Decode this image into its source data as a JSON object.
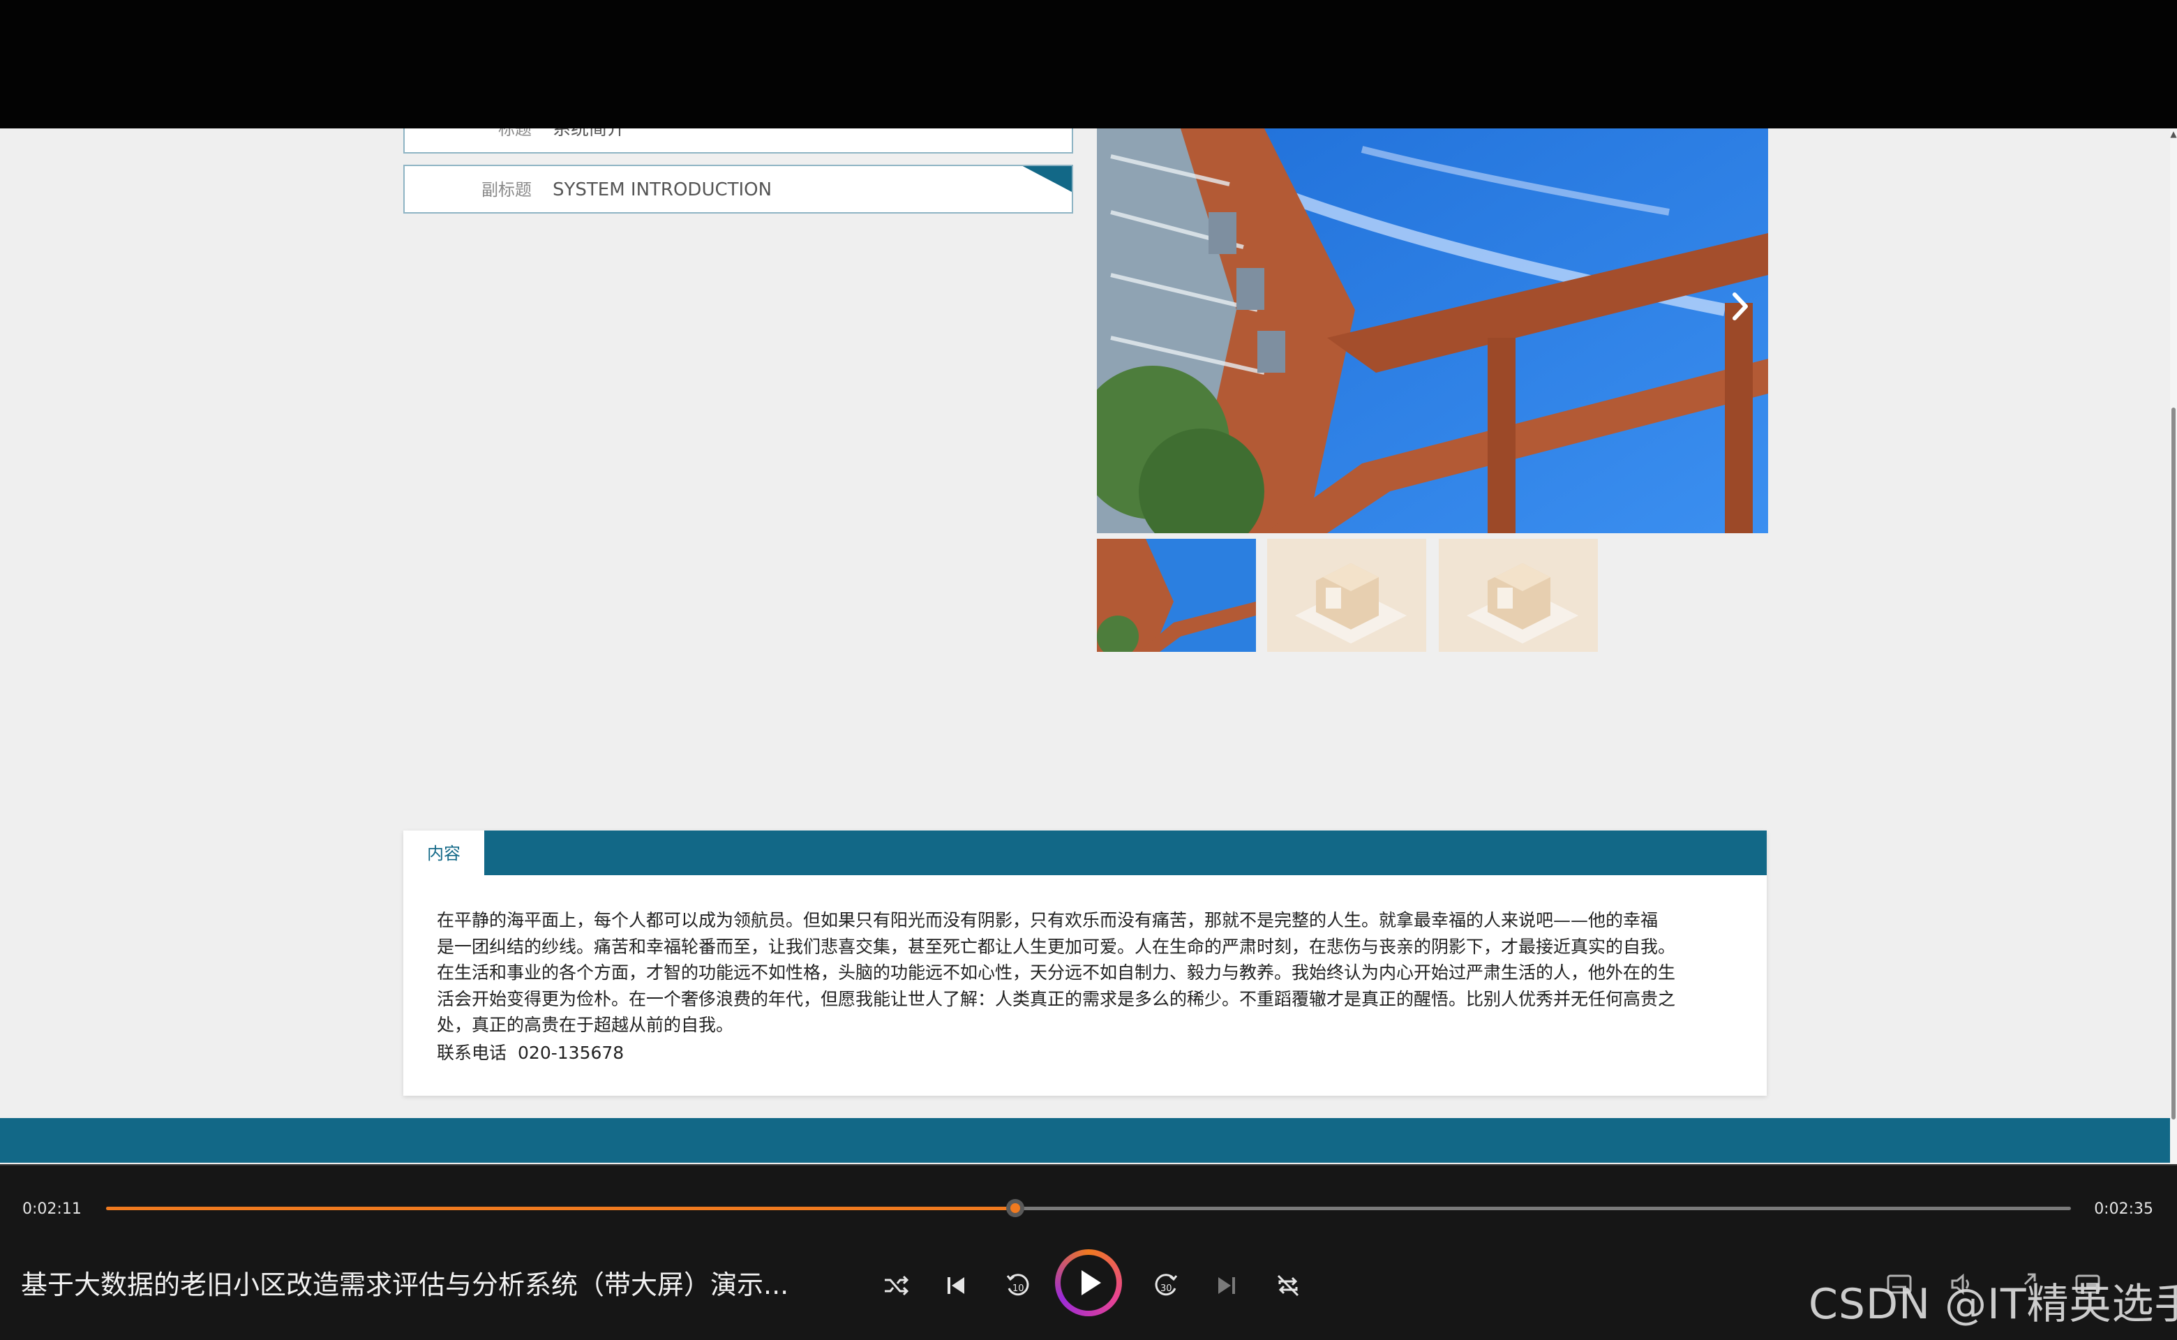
{
  "form": {
    "title_label": "标题",
    "title_value": "系统简介",
    "subtitle_label": "副标题",
    "subtitle_value": "SYSTEM INTRODUCTION"
  },
  "carousel": {
    "next_icon": "chevron-right-icon",
    "thumbnails": [
      "building-photo",
      "box-illustration",
      "box-illustration"
    ]
  },
  "content": {
    "tab_label": "内容",
    "lines": [
      "在平静的海平面上，每个人都可以成为领航员。但如果只有阳光而没有阴影，只有欢乐而没有痛苦，那就不是完整的人生。就拿最幸福的人来说吧——他的幸福",
      "是一团纠结的纱线。痛苦和幸福轮番而至，让我们悲喜交集，甚至死亡都让人生更加可爱。人在生命的严肃时刻，在悲伤与丧亲的阴影下，才最接近真实的自我。",
      "在生活和事业的各个方面，才智的功能远不如性格，头脑的功能远不如心性，天分远不如自制力、毅力与教养。我始终认为内心开始过严肃生活的人，他外在的生",
      "活会开始变得更为俭朴。在一个奢侈浪费的年代，但愿我能让世人了解：人类真正的需求是多么的稀少。不重蹈覆辙才是真正的醒悟。比别人优秀并无任何高贵之",
      "处，真正的高贵在于超越从前的自我。"
    ],
    "contact_label": "联系电话",
    "contact_value": "020-135678"
  },
  "player": {
    "current_time": "0:02:11",
    "total_time": "0:02:35",
    "progress": 0.4626,
    "title": "基于大数据的老旧小区改造需求评估与分析系统（带大屏）演示...",
    "watermark": "CSDN @IT精英选手",
    "accent_color": "#f07a1f",
    "controls": [
      "shuffle-icon",
      "previous-icon",
      "rewind-10-icon",
      "play-icon",
      "forward-30-icon",
      "next-icon",
      "repeat-off-icon"
    ],
    "right_controls": [
      "captions-icon",
      "volume-icon",
      "fullscreen-icon",
      "miniplayer-icon"
    ]
  },
  "colors": {
    "brand": "#126887",
    "page_bg": "#efefef"
  }
}
